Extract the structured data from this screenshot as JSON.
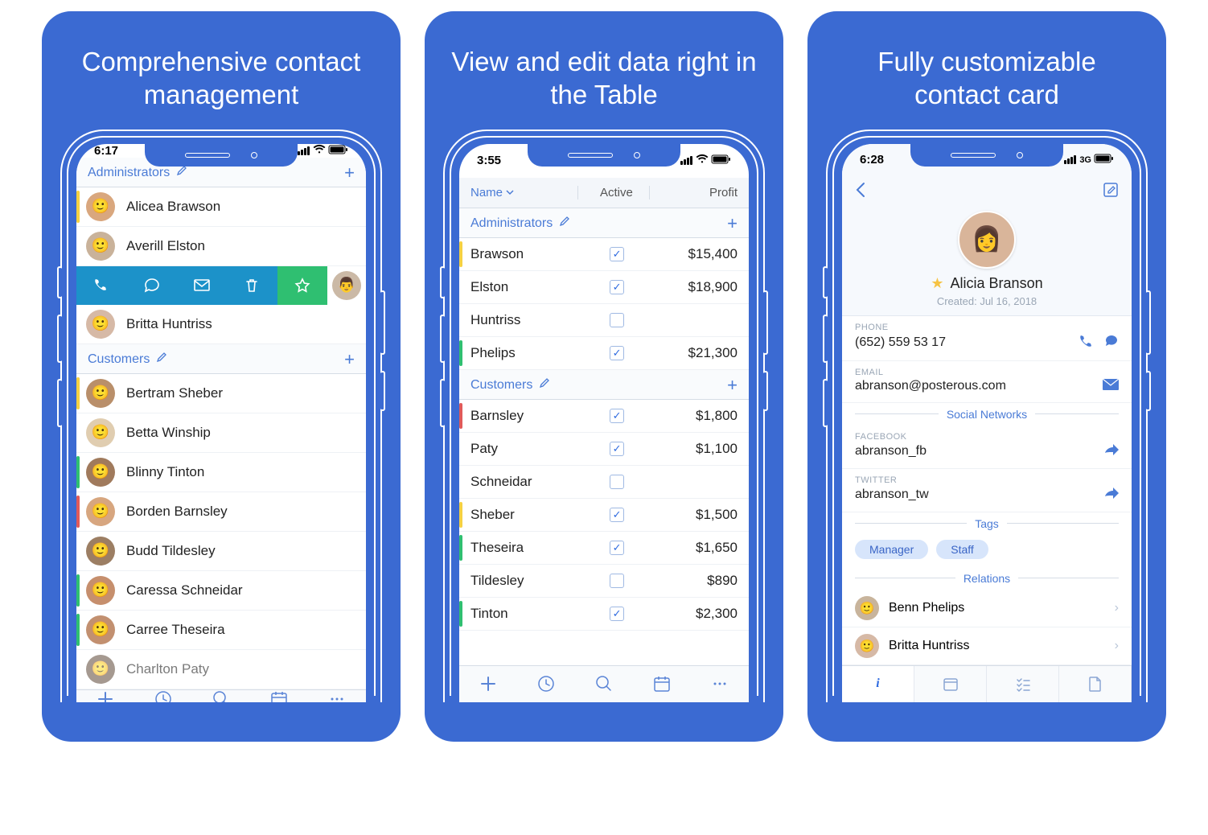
{
  "panels": [
    {
      "title": "Comprehensive contact management"
    },
    {
      "title": "View and edit data right in the Table"
    },
    {
      "title": "Fully customizable contact card"
    }
  ],
  "status": {
    "p1_time": "6:17",
    "p2_time": "3:55",
    "p3_time": "6:28",
    "p3_net": "3G"
  },
  "list": {
    "sections": [
      {
        "name": "Administrators",
        "items": [
          {
            "name": "Alicea Brawson",
            "color": "#f5d142",
            "avatar": "#d9a77e"
          },
          {
            "name": "Averill Elston",
            "color": "",
            "avatar": "#c9b29a"
          }
        ],
        "swiped_avatar": "#cbb9a6",
        "after": [
          {
            "name": "Britta Huntriss",
            "color": "",
            "avatar": "#d6b9a6"
          }
        ]
      },
      {
        "name": "Customers",
        "items": [
          {
            "name": "Bertram Sheber",
            "color": "#f5d142",
            "avatar": "#b98f6a"
          },
          {
            "name": "Betta Winship",
            "color": "",
            "avatar": "#e0cdb0"
          },
          {
            "name": "Blinny Tinton",
            "color": "#2fbf71",
            "avatar": "#a07a5c"
          },
          {
            "name": "Borden Barnsley",
            "color": "#e05a5a",
            "avatar": "#d7a67f"
          },
          {
            "name": "Budd Tildesley",
            "color": "",
            "avatar": "#9c7e63"
          },
          {
            "name": "Caressa Schneidar",
            "color": "#2fbf71",
            "avatar": "#c68f6d"
          },
          {
            "name": "Carree Theseira",
            "color": "#2fbf71",
            "avatar": "#c29070"
          },
          {
            "name": "Charlton Paty",
            "color": "",
            "avatar": "#6a5647"
          }
        ]
      }
    ]
  },
  "table": {
    "cols": {
      "name": "Name",
      "active": "Active",
      "profit": "Profit"
    },
    "sections": [
      {
        "name": "Administrators",
        "rows": [
          {
            "name": "Brawson",
            "active": true,
            "profit": "$15,400",
            "color": "#f5d142"
          },
          {
            "name": "Elston",
            "active": true,
            "profit": "$18,900",
            "color": ""
          },
          {
            "name": "Huntriss",
            "active": false,
            "profit": "",
            "color": ""
          },
          {
            "name": "Phelips",
            "active": true,
            "profit": "$21,300",
            "color": "#2fbf71"
          }
        ]
      },
      {
        "name": "Customers",
        "rows": [
          {
            "name": "Barnsley",
            "active": true,
            "profit": "$1,800",
            "color": "#e05a5a"
          },
          {
            "name": "Paty",
            "active": true,
            "profit": "$1,100",
            "color": ""
          },
          {
            "name": "Schneidar",
            "active": false,
            "profit": "",
            "color": ""
          },
          {
            "name": "Sheber",
            "active": true,
            "profit": "$1,500",
            "color": "#f5d142"
          },
          {
            "name": "Theseira",
            "active": true,
            "profit": "$1,650",
            "color": "#2fbf71"
          },
          {
            "name": "Tildesley",
            "active": false,
            "profit": "$890",
            "color": ""
          },
          {
            "name": "Tinton",
            "active": true,
            "profit": "$2,300",
            "color": "#2fbf71"
          }
        ]
      }
    ]
  },
  "card": {
    "name": "Alicia Branson",
    "created_label": "Created:",
    "created_value": "Jul 16, 2018",
    "phone_label": "PHONE",
    "phone": "(652) 559 53 17",
    "email_label": "EMAIL",
    "email": "abranson@posterous.com",
    "social_title": "Social Networks",
    "facebook_label": "FACEBOOK",
    "facebook": "abranson_fb",
    "twitter_label": "TWITTER",
    "twitter": "abranson_tw",
    "tags_title": "Tags",
    "tags": [
      "Manager",
      "Staff"
    ],
    "relations_title": "Relations",
    "relations": [
      {
        "name": "Benn Phelips",
        "avatar": "#c8b49c"
      },
      {
        "name": "Britta Huntriss",
        "avatar": "#d6b9a6"
      }
    ]
  }
}
